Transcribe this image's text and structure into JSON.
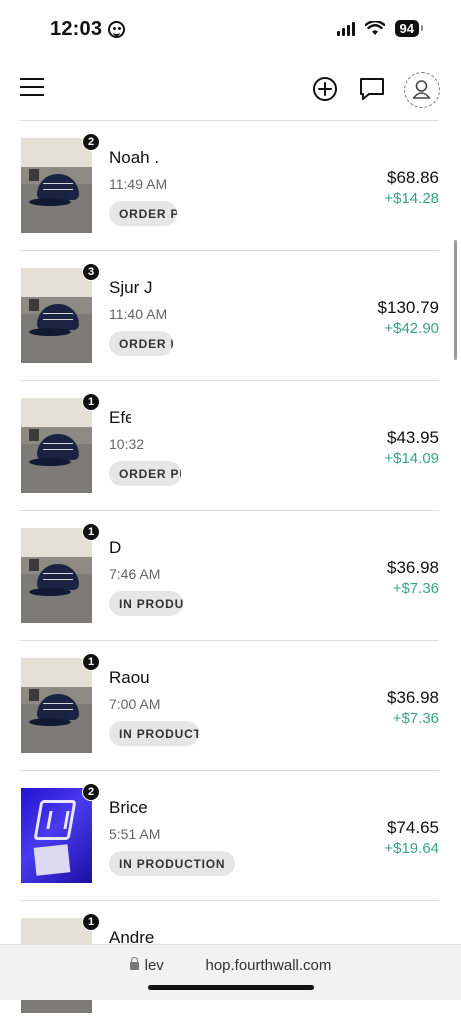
{
  "status_bar": {
    "time": "12:03",
    "battery": "94",
    "time_emoji_icon": "smiley-icon",
    "signal_icon": "cellular-signal-icon",
    "wifi_icon": "wifi-icon"
  },
  "nav": {
    "menu_icon": "hamburger-menu-icon",
    "add_icon": "plus-circle-icon",
    "chat_icon": "chat-bubble-icon",
    "profile_icon": "user-avatar-icon"
  },
  "orders": [
    {
      "badge": "2",
      "name": "Noah .",
      "time": "11:49 AM",
      "status": "ORDER P",
      "price": "$68.86",
      "earnings": "+$14.28",
      "thumb": "navy-cap"
    },
    {
      "badge": "3",
      "name": "Sjur J",
      "time": "11:40 AM",
      "status": "ORDER P",
      "price": "$130.79",
      "earnings": "+$42.90",
      "thumb": "navy-cap"
    },
    {
      "badge": "1",
      "name": "Efe",
      "time": "10:32",
      "status": "ORDER PI",
      "price": "$43.95",
      "earnings": "+$14.09",
      "thumb": "navy-cap"
    },
    {
      "badge": "1",
      "name": "D",
      "time": "7:46 AM",
      "status": "IN PRODU",
      "price": "$36.98",
      "earnings": "+$7.36",
      "thumb": "navy-cap"
    },
    {
      "badge": "1",
      "name": "Raou",
      "time": "7:00 AM",
      "status": "IN PRODUCT",
      "price": "$36.98",
      "earnings": "+$7.36",
      "thumb": "navy-cap"
    },
    {
      "badge": "2",
      "name": "Brice",
      "time": "5:51 AM",
      "status": "IN PRODUCTION",
      "price": "$74.65",
      "earnings": "+$19.64",
      "thumb": "blue-artwork"
    },
    {
      "badge": "1",
      "name": "Andre",
      "time": "",
      "status": "",
      "price": "",
      "earnings": "",
      "thumb": "navy-cap"
    }
  ],
  "browser": {
    "url": "lev          hop.fourthwall.com",
    "lock_icon": "lock-icon"
  },
  "colors": {
    "earnings_green": "#3aa484",
    "pill_bg": "#e6e6e6",
    "badge_bg": "#111111"
  }
}
